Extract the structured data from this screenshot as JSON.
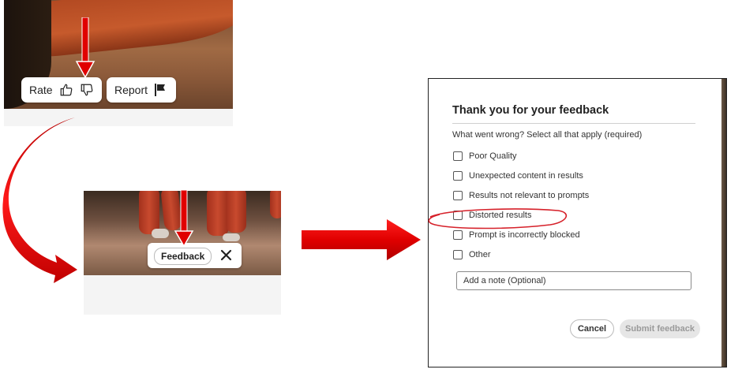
{
  "panel_rate": {
    "rate_label": "Rate",
    "report_label": "Report",
    "icons": [
      "thumbs-up-icon",
      "thumbs-down-icon",
      "flag-icon"
    ]
  },
  "panel_feedback": {
    "feedback_label": "Feedback",
    "icons": [
      "close-icon"
    ]
  },
  "dialog": {
    "title": "Thank you for your feedback",
    "question": "What went wrong? Select all that apply (required)",
    "options": [
      "Poor Quality",
      "Unexpected content in results",
      "Results not relevant to prompts",
      "Distorted results",
      "Prompt is incorrectly blocked",
      "Other"
    ],
    "note_placeholder": "Add a note (Optional)",
    "cancel_label": "Cancel",
    "submit_label": "Submit feedback"
  },
  "colors": {
    "arrow": "#e00000",
    "highlight": "#d6212a",
    "submit_disabled_bg": "#e6e6e6"
  }
}
